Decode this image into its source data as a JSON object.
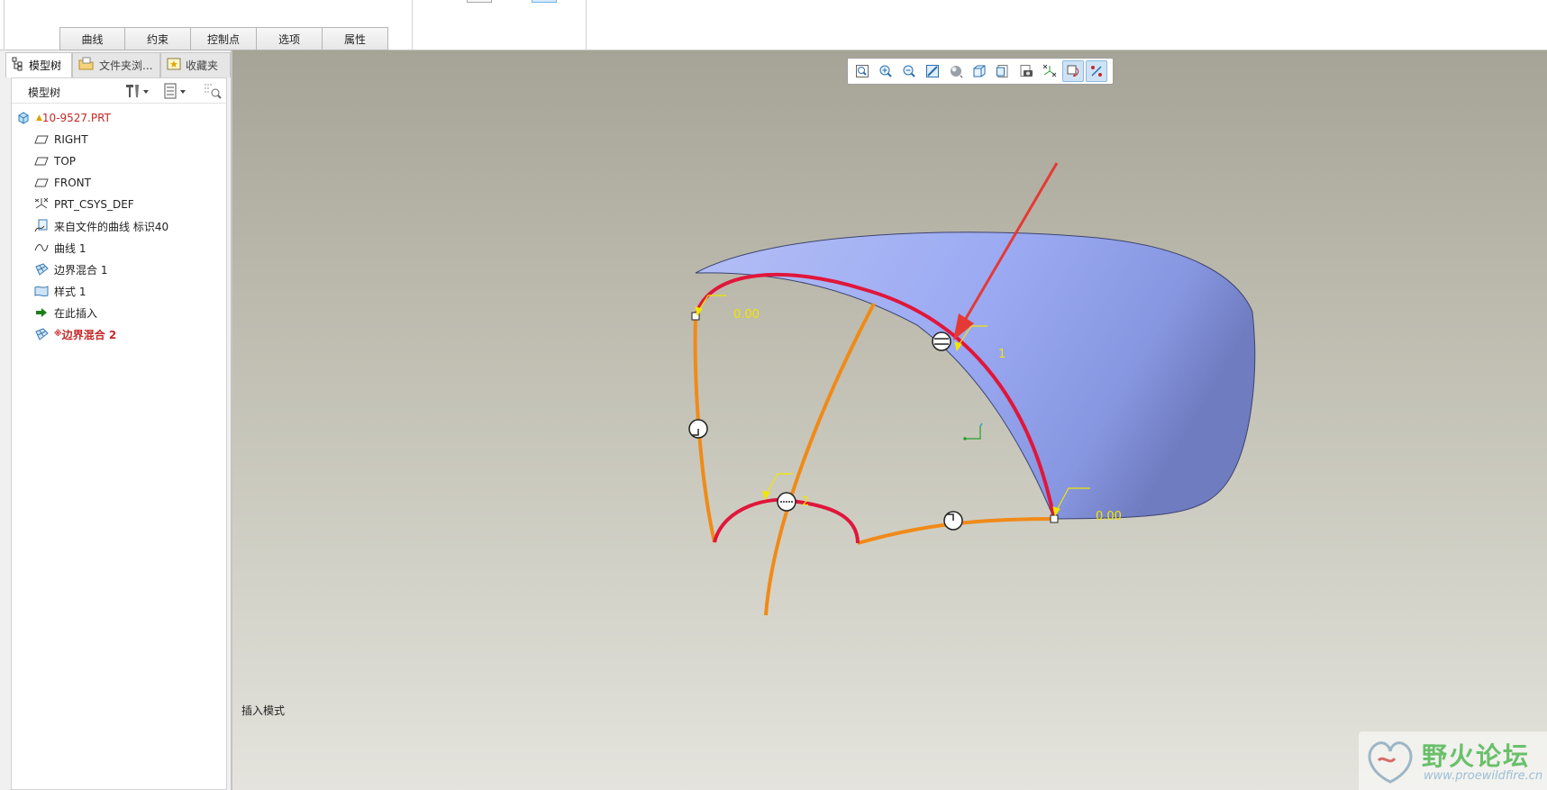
{
  "dashboard": {
    "tabs": [
      {
        "label": "曲线"
      },
      {
        "label": "约束"
      },
      {
        "label": "控制点"
      },
      {
        "label": "选项"
      },
      {
        "label": "属性"
      }
    ]
  },
  "navigator": {
    "tabs": [
      {
        "label": "模型树",
        "icon": "model-tree-icon",
        "active": true
      },
      {
        "label": "文件夹浏...",
        "icon": "folder-browser-icon",
        "active": false
      },
      {
        "label": "收藏夹",
        "icon": "favorites-icon",
        "active": false
      }
    ],
    "tree_title": "模型树",
    "items": [
      {
        "label": "10-9527.PRT",
        "icon": "part-icon",
        "color": "#c62828"
      },
      {
        "label": "RIGHT",
        "icon": "datum-plane-icon"
      },
      {
        "label": "TOP",
        "icon": "datum-plane-icon"
      },
      {
        "label": "FRONT",
        "icon": "datum-plane-icon"
      },
      {
        "label": "PRT_CSYS_DEF",
        "icon": "coordinate-system-icon"
      },
      {
        "label": "来自文件的曲线 标识40",
        "icon": "curve-from-file-icon"
      },
      {
        "label": "曲线 1",
        "icon": "curve-icon"
      },
      {
        "label": "边界混合 1",
        "icon": "boundary-blend-icon"
      },
      {
        "label": "样式 1",
        "icon": "style-icon"
      },
      {
        "label": "在此插入",
        "icon": "insert-here-arrow-icon",
        "color": "#1a7f1a"
      },
      {
        "label": "边界混合 2",
        "icon": "boundary-blend-icon",
        "color": "#c62828"
      }
    ]
  },
  "viewport": {
    "mode_label": "插入模式",
    "annotations": {
      "tangent_top_left": "0.00",
      "tangent_bottom_right": "0.00",
      "direction_1": "1",
      "direction_2": "2"
    },
    "colors": {
      "surface": "#9aa9f2",
      "first_direction_curve": "#e0163b",
      "second_direction_curve": "#f08a18",
      "callout": "#f2e600",
      "pointer_arrow": "#e53935"
    }
  },
  "view_toolbar": {
    "buttons": [
      "refit-icon",
      "zoom-in-icon",
      "zoom-out-icon",
      "repaint-icon",
      "display-style-icon",
      "saved-orientations-icon",
      "view-manager-icon",
      "named-views-icon",
      "datum-display-icon",
      "spin-center-icon",
      "annotation-display-icon"
    ]
  },
  "watermark": {
    "title": "野火论坛",
    "url": "www.proewildfire.cn"
  }
}
